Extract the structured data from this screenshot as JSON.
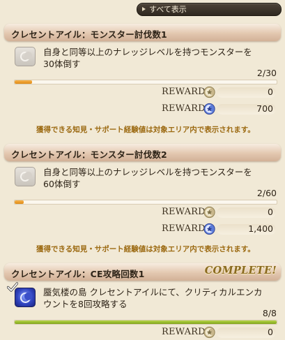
{
  "show_all": {
    "label": "すべて表示"
  },
  "reward_label": "REWARD",
  "quests": [
    {
      "title": "クレセントアイル：モンスター討伐数1",
      "description": [
        "自身と同等以上のナレッジレベルを持つモンスターを",
        "30体倒す"
      ],
      "progress_text": "2/30",
      "progress": 0.0667,
      "complete": false,
      "rewards": [
        {
          "icon": "knowledge-exp-icon",
          "value": "0"
        },
        {
          "icon": "support-exp-icon",
          "value": "700"
        }
      ],
      "note": "獲得できる知見・サポート経験値は対象エリア内で表示されます。"
    },
    {
      "title": "クレセントアイル：モンスター討伐数2",
      "description": [
        "自身と同等以上のナレッジレベルを持つモンスターを",
        "60体倒す"
      ],
      "progress_text": "2/60",
      "progress": 0.0333,
      "complete": false,
      "rewards": [
        {
          "icon": "knowledge-exp-icon",
          "value": "0"
        },
        {
          "icon": "support-exp-icon",
          "value": "1,400"
        }
      ],
      "note": "獲得できる知見・サポート経験値は対象エリア内で表示されます。"
    },
    {
      "title": "クレセントアイル：CE攻略回数1",
      "complete_label": "COMPLETE!",
      "description": [
        "蜃気楼の島 クレセントアイルにて、クリティカルエンカ",
        "ウントを8回攻略する"
      ],
      "progress_text": "8/8",
      "progress": 1.0,
      "complete": true,
      "rewards": [
        {
          "icon": "knowledge-exp-icon",
          "value": "0"
        }
      ]
    }
  ],
  "colors": {
    "progress_active": "#e8981f",
    "progress_complete": "#8db022",
    "note": "#9c6a12"
  }
}
